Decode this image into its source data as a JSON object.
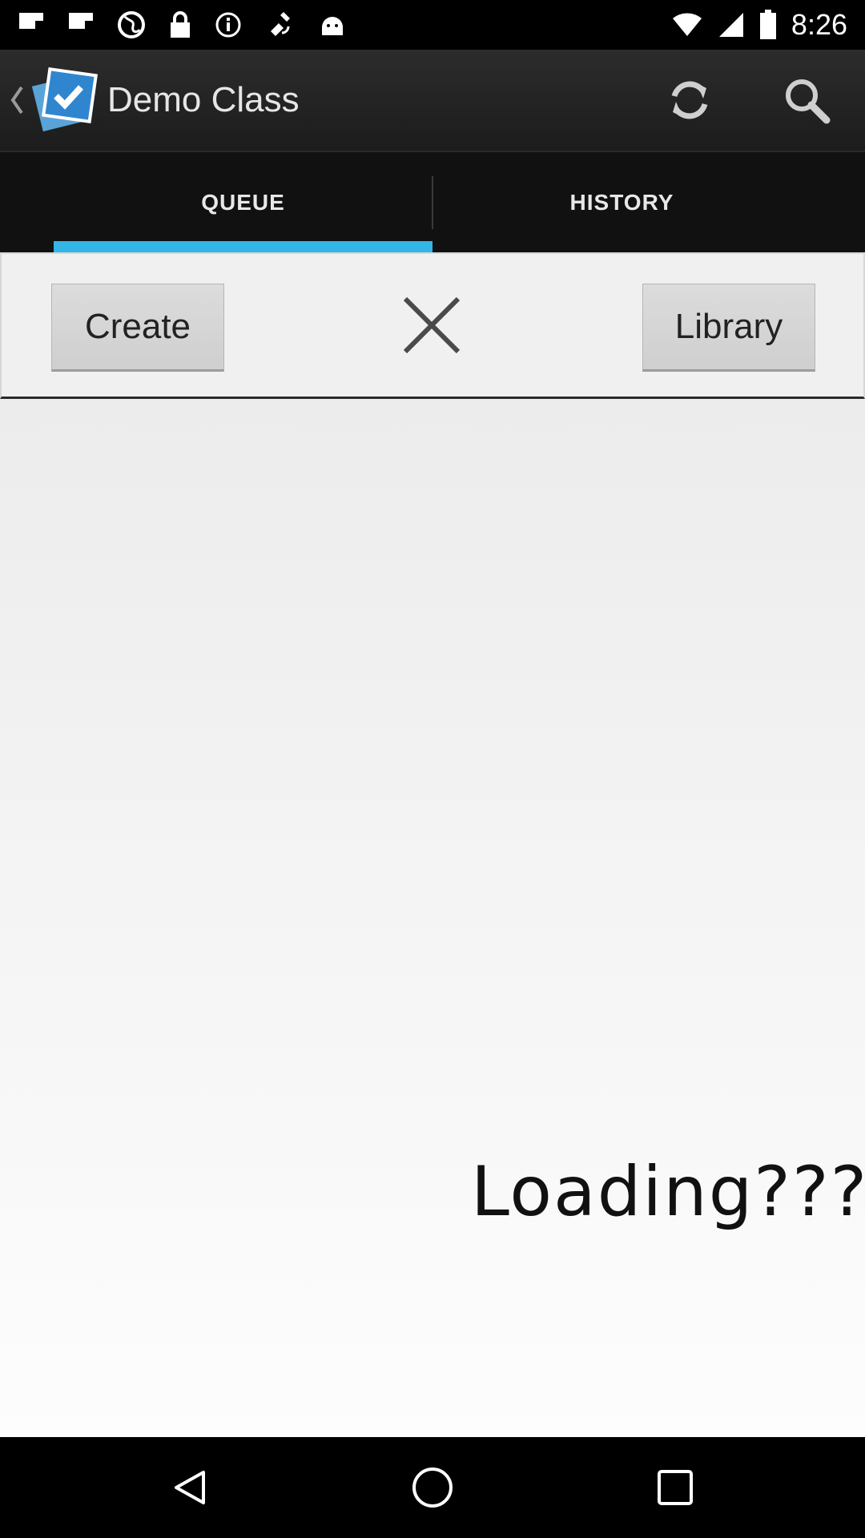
{
  "status_bar": {
    "time": "8:26",
    "left_icons": [
      "flipboard-icon",
      "flipboard-icon",
      "globe-icon",
      "lock-icon",
      "info-icon",
      "satellite-icon",
      "android-icon"
    ],
    "right_icons": [
      "wifi-icon",
      "signal-icon",
      "battery-icon"
    ]
  },
  "action_bar": {
    "title": "Demo Class",
    "logo": "checkmark-icon",
    "actions": [
      "refresh-icon",
      "search-icon"
    ]
  },
  "tabs": [
    {
      "label": "QUEUE",
      "selected": true
    },
    {
      "label": "HISTORY",
      "selected": false
    }
  ],
  "accent_color": "#33b5e5",
  "toolbar": {
    "create_label": "Create",
    "library_label": "Library",
    "close_icon": "close-icon"
  },
  "content": {
    "loading_text": "Loading???"
  },
  "nav_bar": {
    "buttons": [
      "back-icon",
      "home-icon",
      "recent-apps-icon"
    ]
  }
}
